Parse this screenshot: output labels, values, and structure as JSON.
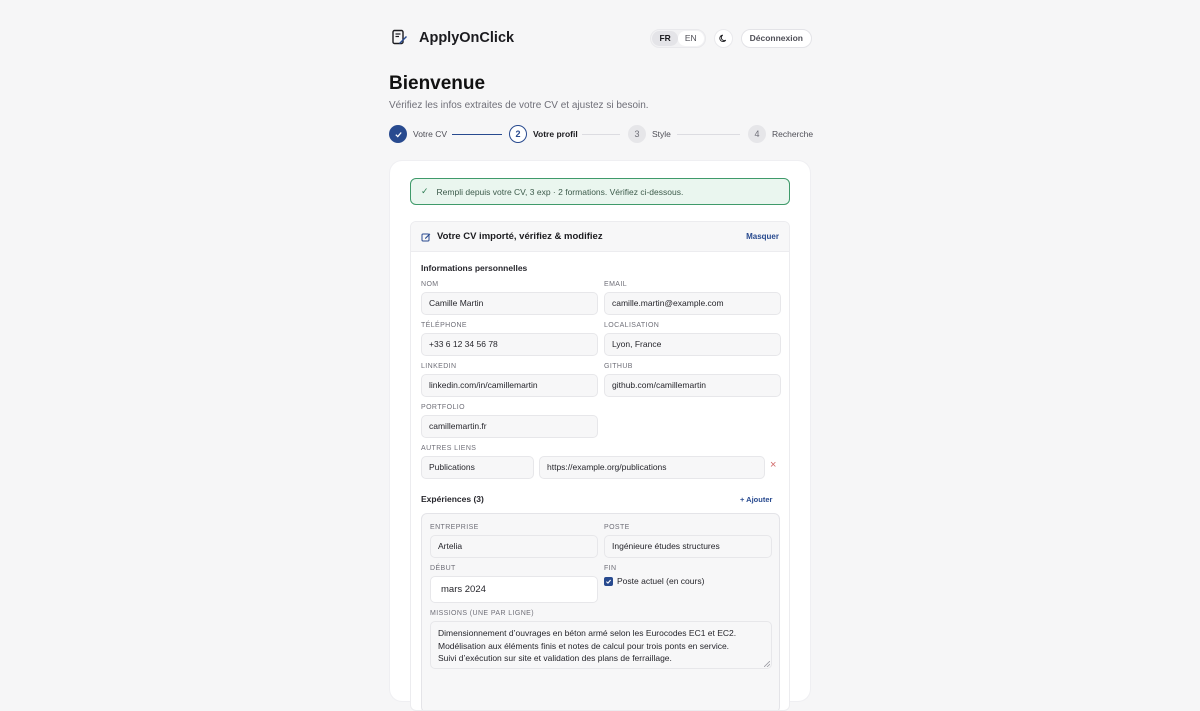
{
  "header": {
    "app_name": "ApplyOnClick",
    "logo_icon": "document-pen-icon",
    "languages": [
      "FR",
      "EN"
    ],
    "active_language": "FR",
    "theme_icon": "moon-icon",
    "logout_label": "Déconnexion"
  },
  "page": {
    "title": "Bienvenue",
    "subtitle": "Vérifiez les infos extraites de votre CV et ajustez si besoin."
  },
  "stepper": {
    "steps": [
      {
        "number": "1",
        "label": "Votre CV",
        "state": "done"
      },
      {
        "number": "2",
        "label": "Votre profil",
        "state": "current"
      },
      {
        "number": "3",
        "label": "Style",
        "state": "todo"
      },
      {
        "number": "4",
        "label": "Recherche",
        "state": "todo"
      }
    ]
  },
  "notice": {
    "text": "Rempli depuis votre CV, 3 exp · 2 formations. Vérifiez ci-dessous."
  },
  "panel": {
    "title": "Votre CV importé, vérifiez & modifiez",
    "hide_label": "Masquer",
    "personal_title": "Informations personnelles",
    "labels": {
      "name": "NOM",
      "email": "EMAIL",
      "phone": "TÉLÉPHONE",
      "location": "LOCALISATION",
      "linkedin": "LINKEDIN",
      "github": "GITHUB",
      "portfolio": "PORTFOLIO",
      "other_links": "AUTRES LIENS"
    },
    "values": {
      "name": "Camille Martin",
      "email": "camille.martin@example.com",
      "phone": "+33 6 12 34 56 78",
      "location": "Lyon, France",
      "linkedin": "linkedin.com/in/camillemartin",
      "github": "github.com/camillemartin",
      "portfolio": "camillemartin.fr",
      "other_link_label": "Publications",
      "other_link_url": "https://example.org/publications"
    },
    "experiences_title": "Expériences (3)",
    "add_label": "+ Ajouter",
    "experience": {
      "labels": {
        "company": "ENTREPRISE",
        "position": "POSTE",
        "start": "DÉBUT",
        "end": "FIN",
        "missions": "MISSIONS (UNE PAR LIGNE)"
      },
      "company": "Artelia",
      "position": "Ingénieure études structures",
      "start": "mars  2024",
      "current_label": "Poste actuel (en cours)",
      "current_checked": true,
      "missions": [
        "Dimensionnement d’ouvrages en béton armé selon les Eurocodes EC1 et EC2.",
        "Modélisation aux éléments finis et notes de calcul pour trois ponts en service.",
        "Suivi d’exécution sur site et validation des plans de ferraillage."
      ]
    }
  },
  "colors": {
    "accent": "#284a8f",
    "success_border": "#3f9a6a",
    "success_bg": "#eaf6ef",
    "danger": "#d26a6a"
  }
}
